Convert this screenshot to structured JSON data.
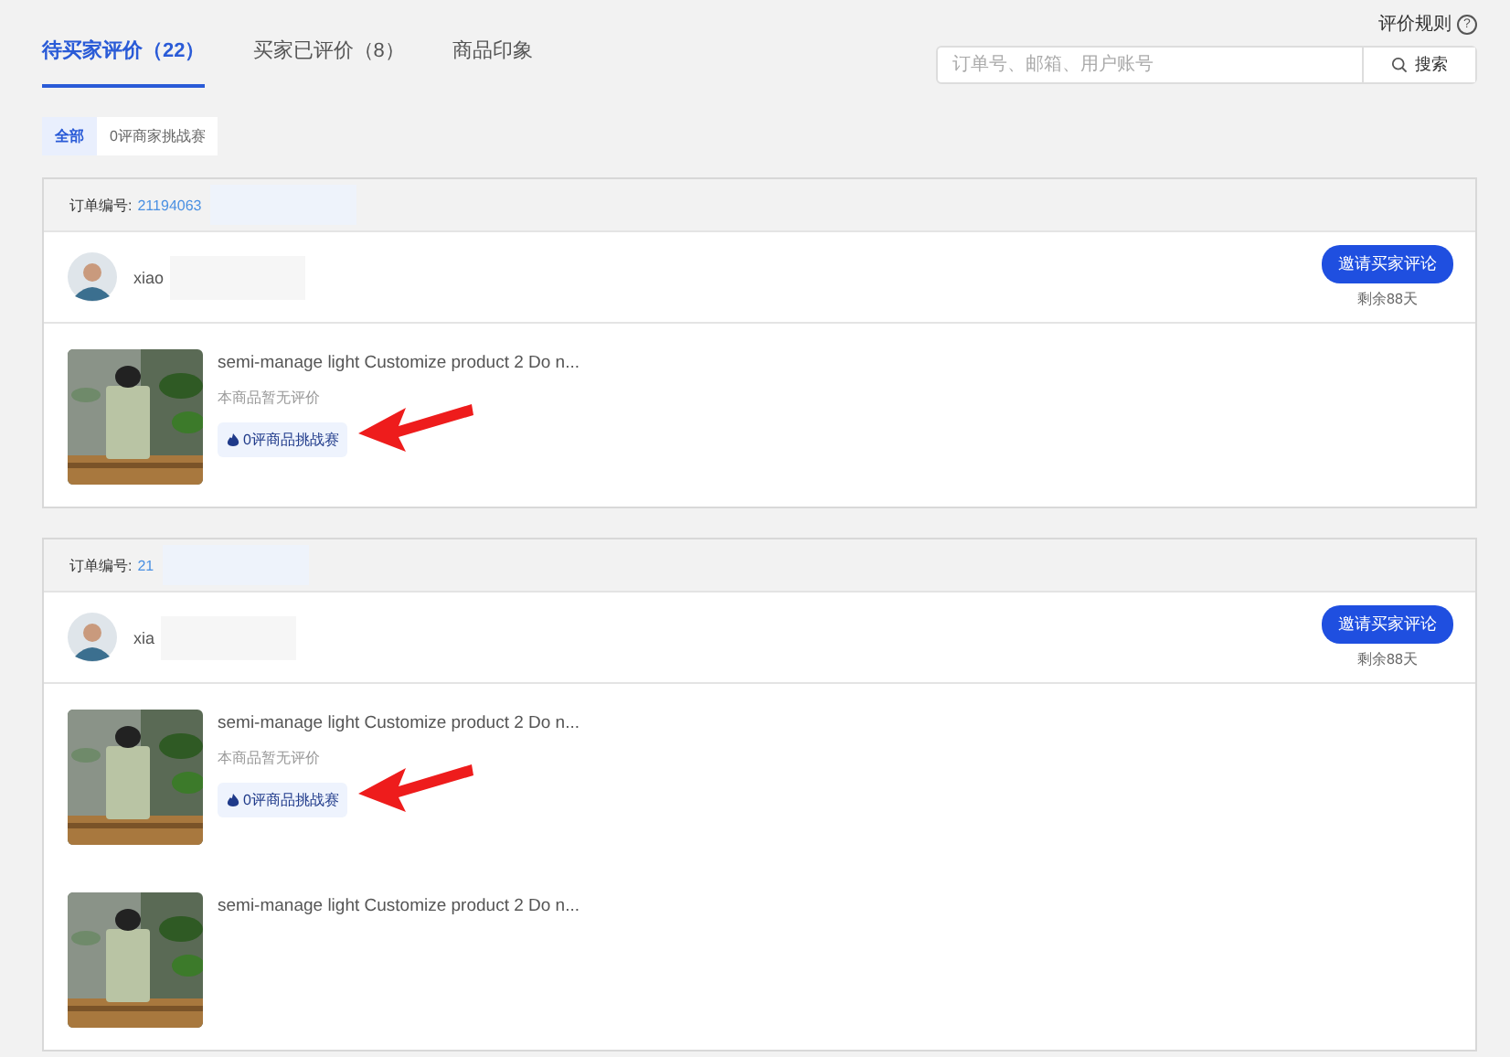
{
  "rules_link": {
    "label": "评价规则",
    "icon": "?"
  },
  "tabs": [
    {
      "label": "待买家评价（22）",
      "selected": true
    },
    {
      "label": "买家已评价（8）",
      "selected": false
    },
    {
      "label": "商品印象",
      "selected": false
    }
  ],
  "search": {
    "placeholder": "订单号、邮箱、用户账号",
    "button": "搜索"
  },
  "filters": [
    {
      "label": "全部",
      "selected": true
    },
    {
      "label": "0评商家挑战赛",
      "selected": false
    }
  ],
  "orders": [
    {
      "order_label": "订单编号:",
      "order_no": "21194063",
      "buyer": "xiao",
      "invite_button": "邀请买家评论",
      "remaining": "剩余88天",
      "products": [
        {
          "title": "semi-manage light Customize product 2 Do n...",
          "review_status": "本商品暂无评价",
          "challenge_tag": "0评商品挑战赛",
          "annotated": true
        }
      ]
    },
    {
      "order_label": "订单编号:",
      "order_no": "21",
      "buyer": "xia",
      "invite_button": "邀请买家评论",
      "remaining": "剩余88天",
      "products": [
        {
          "title": "semi-manage light Customize product 2 Do n...",
          "review_status": "本商品暂无评价",
          "challenge_tag": "0评商品挑战赛",
          "annotated": true
        },
        {
          "title": "semi-manage light Customize product 2 Do n...",
          "annotated": false
        }
      ]
    }
  ]
}
